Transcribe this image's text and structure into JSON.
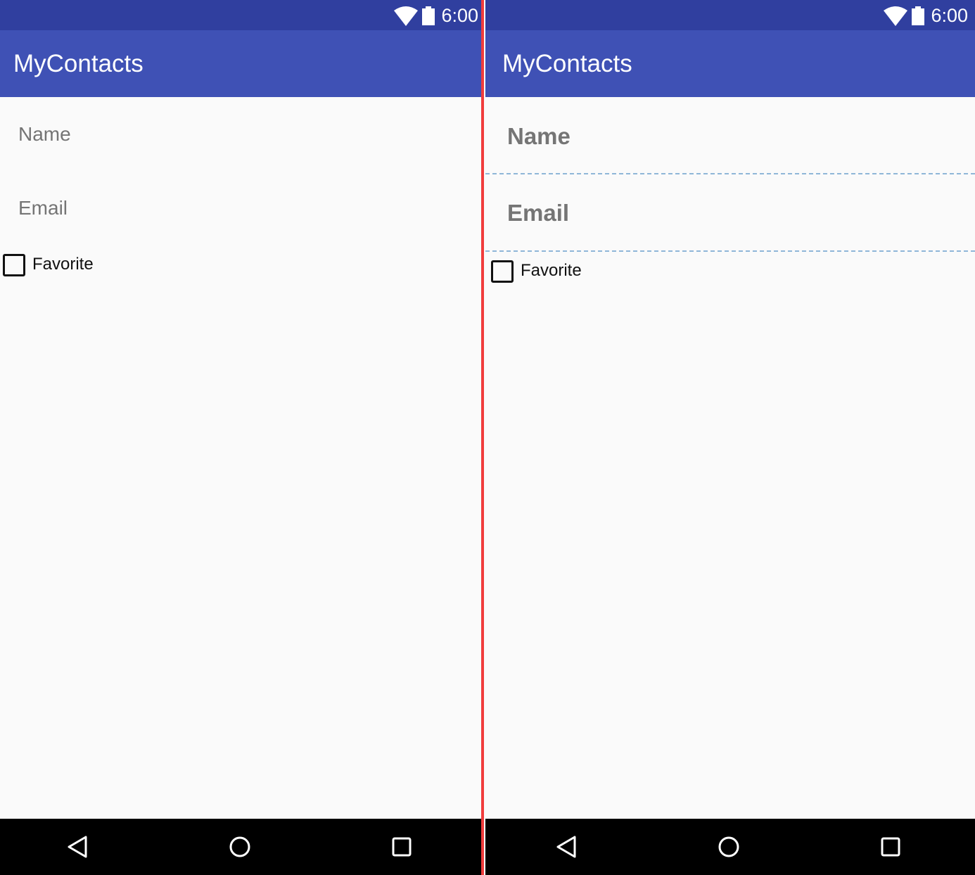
{
  "left_screen": {
    "status_time": "6:00",
    "app_title": "MyContacts",
    "name_hint": "Name",
    "email_hint": "Email",
    "favorite_label": "Favorite"
  },
  "right_screen": {
    "status_time": "6:00",
    "app_title": "MyContacts",
    "name_hint": "Name",
    "email_hint": "Email",
    "favorite_label": "Favorite"
  },
  "icons": {
    "status": [
      "wifi-icon",
      "battery-icon"
    ],
    "navigation": [
      "back-icon",
      "home-icon",
      "recents-icon"
    ]
  },
  "colors": {
    "status_bar": "#303f9f",
    "app_bar": "#3f51b5",
    "background": "#fafafa",
    "hint_text": "#757575",
    "divider": "#f03c3c",
    "dashed_guide": "#8fb6d8",
    "nav_bar": "#000000"
  }
}
